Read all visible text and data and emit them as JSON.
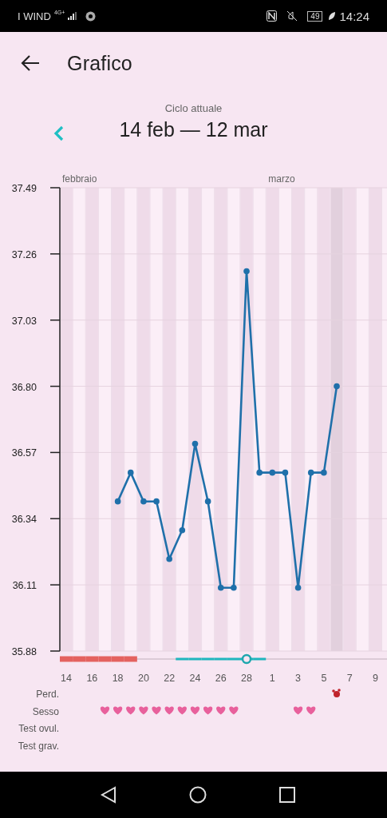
{
  "status_bar": {
    "carrier": "I WIND",
    "network": "4G+",
    "battery": "49",
    "time": "14:24"
  },
  "header": {
    "title": "Grafico"
  },
  "cycle": {
    "caption": "Ciclo attuale",
    "range": "14 feb — 12 mar"
  },
  "chart": {
    "rows": [
      "Perd.",
      "Sesso",
      "Test ovul.",
      "Test grav."
    ],
    "chart_data": {
      "type": "line",
      "categories": [
        "14",
        null,
        "16",
        null,
        "18",
        null,
        "20",
        null,
        "22",
        null,
        "24",
        null,
        "26",
        null,
        "28",
        null,
        "1",
        null,
        "3",
        null,
        "5",
        null,
        "7",
        null,
        "9",
        null
      ],
      "series": [
        {
          "color": "#1f70aa",
          "values": [
            null,
            null,
            null,
            null,
            36.4,
            36.5,
            36.4,
            36.4,
            36.2,
            36.3,
            36.6,
            36.4,
            36.1,
            36.1,
            37.2,
            36.5,
            36.5,
            36.5,
            36.1,
            36.5,
            36.5,
            36.8,
            null,
            null,
            null,
            null
          ]
        }
      ],
      "grid": true,
      "marker": true,
      "ylim": [
        35.88,
        37.49
      ],
      "yticks": [
        {
          "value": 35.88,
          "label": "35.88"
        },
        {
          "value": 36.11,
          "label": "36.11"
        },
        {
          "value": 36.34,
          "label": "36.34"
        },
        {
          "value": 36.57,
          "label": "36.57"
        },
        {
          "value": 36.8,
          "label": "36.80"
        },
        {
          "value": 37.03,
          "label": "37.03"
        },
        {
          "value": 37.26,
          "label": "37.26"
        },
        {
          "value": 37.49,
          "label": "37.49"
        }
      ]
    },
    "days": [
      {
        "month": "febbraio",
        "period": true,
        "fertile": false,
        "ovulation": false,
        "today": false,
        "bleeding": false,
        "sex": false
      },
      {
        "period": true,
        "fertile": false,
        "ovulation": false,
        "today": false,
        "bleeding": false,
        "sex": false
      },
      {
        "period": true,
        "fertile": false,
        "ovulation": false,
        "today": false,
        "bleeding": false,
        "sex": false
      },
      {
        "period": true,
        "fertile": false,
        "ovulation": false,
        "today": false,
        "bleeding": false,
        "sex": true
      },
      {
        "period": true,
        "fertile": false,
        "ovulation": false,
        "today": false,
        "bleeding": false,
        "sex": true
      },
      {
        "period": true,
        "fertile": false,
        "ovulation": false,
        "today": false,
        "bleeding": false,
        "sex": true
      },
      {
        "period": false,
        "fertile": false,
        "ovulation": false,
        "today": false,
        "bleeding": false,
        "sex": true
      },
      {
        "period": false,
        "fertile": false,
        "ovulation": false,
        "today": false,
        "bleeding": false,
        "sex": true
      },
      {
        "period": false,
        "fertile": false,
        "ovulation": false,
        "today": false,
        "bleeding": false,
        "sex": true
      },
      {
        "period": false,
        "fertile": true,
        "ovulation": false,
        "today": false,
        "bleeding": false,
        "sex": true
      },
      {
        "period": false,
        "fertile": true,
        "ovulation": false,
        "today": false,
        "bleeding": false,
        "sex": true
      },
      {
        "period": false,
        "fertile": true,
        "ovulation": false,
        "today": false,
        "bleeding": false,
        "sex": true
      },
      {
        "period": false,
        "fertile": true,
        "ovulation": false,
        "today": false,
        "bleeding": false,
        "sex": true
      },
      {
        "period": false,
        "fertile": true,
        "ovulation": false,
        "today": false,
        "bleeding": false,
        "sex": true
      },
      {
        "period": false,
        "fertile": true,
        "ovulation": true,
        "today": false,
        "bleeding": false,
        "sex": false
      },
      {
        "period": false,
        "fertile": true,
        "ovulation": false,
        "today": false,
        "bleeding": false,
        "sex": false
      },
      {
        "month": "marzo",
        "period": false,
        "fertile": false,
        "ovulation": false,
        "today": false,
        "bleeding": false,
        "sex": false
      },
      {
        "period": false,
        "fertile": false,
        "ovulation": false,
        "today": false,
        "bleeding": false,
        "sex": false
      },
      {
        "period": false,
        "fertile": false,
        "ovulation": false,
        "today": false,
        "bleeding": false,
        "sex": true
      },
      {
        "period": false,
        "fertile": false,
        "ovulation": false,
        "today": false,
        "bleeding": false,
        "sex": true
      },
      {
        "period": false,
        "fertile": false,
        "ovulation": false,
        "today": false,
        "bleeding": false,
        "sex": false
      },
      {
        "period": false,
        "fertile": false,
        "ovulation": false,
        "today": true,
        "bleeding": true,
        "sex": false
      },
      {
        "period": false,
        "fertile": false,
        "ovulation": false,
        "today": false,
        "bleeding": false,
        "sex": false
      },
      {
        "period": false,
        "fertile": false,
        "ovulation": false,
        "today": false,
        "bleeding": false,
        "sex": false
      },
      {
        "period": false,
        "fertile": false,
        "ovulation": false,
        "today": false,
        "bleeding": false,
        "sex": false
      },
      {
        "period": false,
        "fertile": false,
        "ovulation": false,
        "today": false,
        "bleeding": false,
        "sex": false
      }
    ]
  }
}
